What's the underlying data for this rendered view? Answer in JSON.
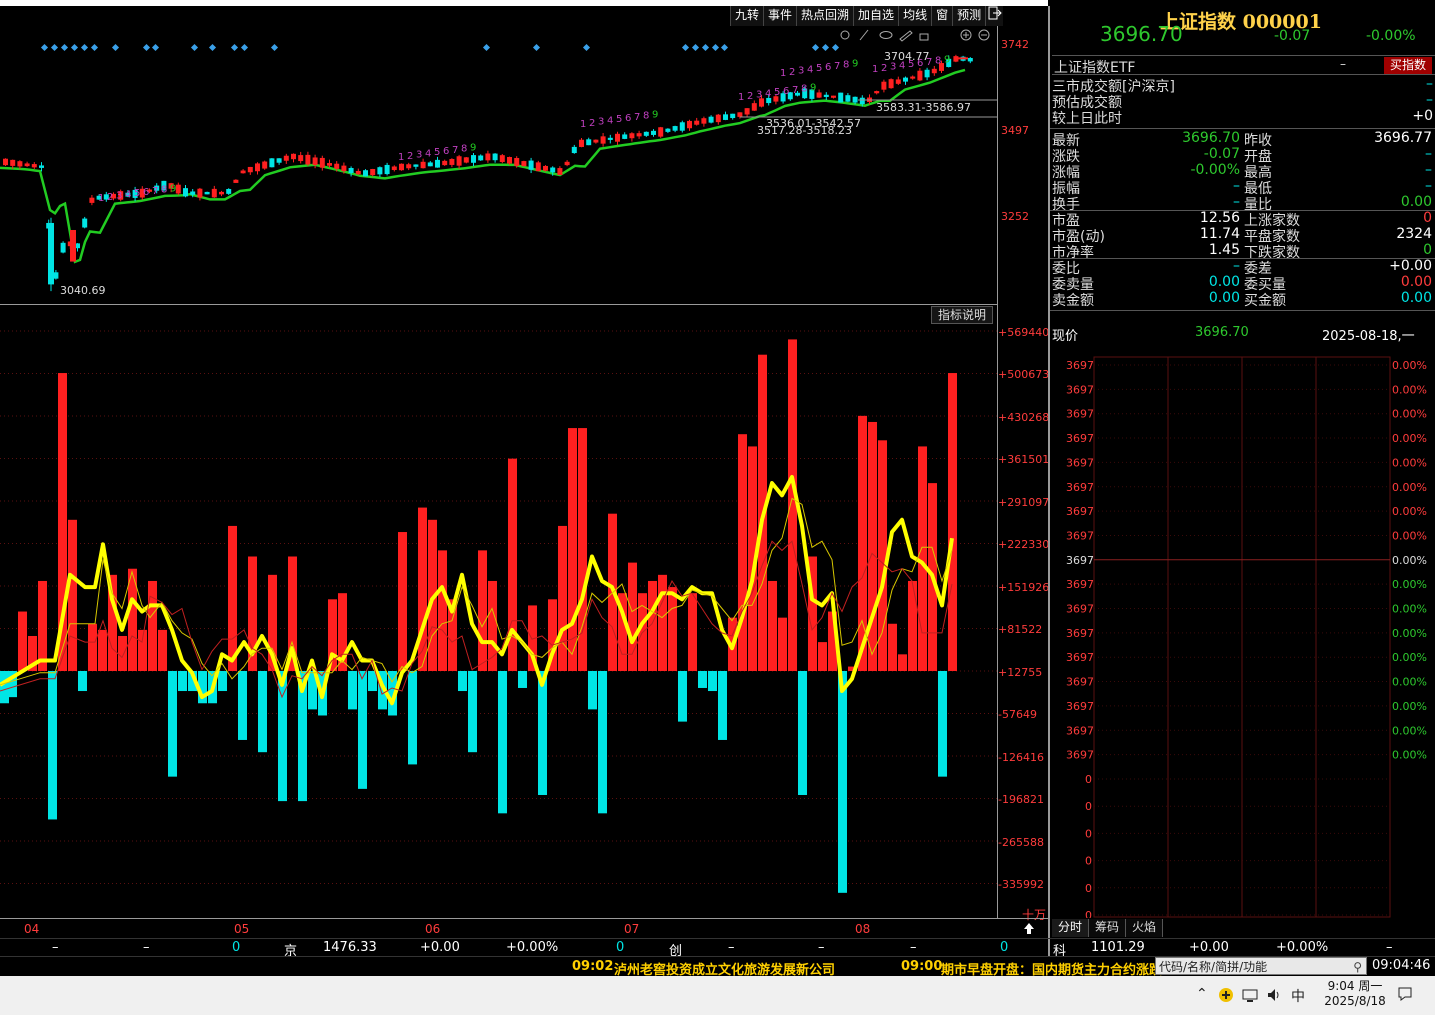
{
  "toolbar": {
    "items": [
      "九转",
      "事件",
      "热点回溯",
      "加自选",
      "均线",
      "窗",
      "预测"
    ],
    "exit_icon": "exit-icon"
  },
  "main_chart": {
    "price_labels": [
      "3742",
      "3497",
      "3252"
    ],
    "low_marker": "3040.69",
    "high_marker": "3704.77",
    "range_label_1": "3583.31-3586.97",
    "range_label_2": "3536.01-3542.57",
    "range_label_3": "3517.28-3518.23",
    "icons": [
      "settings-icon",
      "brush-icon",
      "eye-icon",
      "ruler-icon",
      "lock-icon",
      "zoom-in-icon",
      "zoom-out-icon"
    ]
  },
  "volume_chart": {
    "indicator_button": "指标说明",
    "axis_labels": [
      "+569440",
      "+500673",
      "+430268",
      "+361501",
      "+291097",
      "+222330",
      "+151926",
      "+81522",
      "+12755",
      "-57649",
      "-126416",
      "-196821",
      "-265588",
      "-335992"
    ],
    "unit": "十万"
  },
  "x_axis": {
    "months": [
      "04",
      "05",
      "06",
      "07",
      "08"
    ]
  },
  "index_strip": {
    "dash1": "–",
    "dash2": "–",
    "zero1": "0",
    "jing_label": "京",
    "jing_value": "1476.33",
    "jing_change": "+0.00",
    "jing_pct": "+0.00%",
    "zero2": "0",
    "chuang_label": "创",
    "dash3": "–",
    "dash4": "–",
    "dash5": "–",
    "dash6": "–",
    "zero3": "0",
    "ke_label": "科",
    "ke_value": "1101.29",
    "ke_change": "+0.00",
    "ke_pct": "+0.00%",
    "dash7": "–"
  },
  "ticker": {
    "news1_time": "09:02",
    "news1": "泸州老窖投资成立文化旅游发展新公司",
    "news2_time": "09:00",
    "news2": "期市早盘开盘：国内期货主力合约涨跌",
    "search_placeholder": "代码/名称/简拼/功能",
    "clock": "09:04:46"
  },
  "taskbar": {
    "ime": "中",
    "time": "9:04 周一",
    "date": "2025/8/18"
  },
  "right_panel": {
    "title": "上证指数 000001",
    "price": "3696.70",
    "change": "-0.07",
    "change_pct": "-0.00%",
    "etf_label": "上证指数ETF",
    "etf_dash": "–",
    "buy_button": "买指数",
    "market_rows": [
      {
        "label": "三市成交额[沪深京]",
        "value": "–"
      },
      {
        "label": "预估成交额",
        "value": "–"
      },
      {
        "label": "较上日此时",
        "value": "+0"
      }
    ],
    "quote": {
      "latest_label": "最新",
      "latest": "3696.70",
      "prev_close_label": "昨收",
      "prev_close": "3696.77",
      "change_label": "涨跌",
      "change": "-0.07",
      "open_label": "开盘",
      "open": "–",
      "pct_label": "涨幅",
      "pct": "-0.00%",
      "high_label": "最高",
      "high": "–",
      "amp_label": "振幅",
      "amp": "–",
      "low_label": "最低",
      "low": "–",
      "turnover_label": "换手",
      "turnover": "–",
      "vol_ratio_label": "量比",
      "vol_ratio": "0.00",
      "pe_label": "市盈",
      "pe": "12.56",
      "up_label": "上涨家数",
      "up": "0",
      "pe_dyn_label": "市盈(动)",
      "pe_dyn": "11.74",
      "flat_label": "平盘家数",
      "flat": "2324",
      "pb_label": "市净率",
      "pb": "1.45",
      "down_label": "下跌家数",
      "down": "0",
      "bid_ratio_label": "委比",
      "bid_ratio": "–",
      "bid_diff_label": "委差",
      "bid_diff": "+0.00",
      "sell_vol_label": "委卖量",
      "sell_vol": "0.00",
      "buy_vol_label": "委买量",
      "buy_vol": "0.00",
      "sell_amt_label": "卖金额",
      "sell_amt": "0.00",
      "buy_amt_label": "买金额",
      "buy_amt": "0.00"
    },
    "minute": {
      "now_label": "现价",
      "now_value": "3696.70",
      "date": "2025-08-18,一",
      "price_labels": [
        "3697",
        "3697",
        "3697",
        "3697",
        "3697",
        "3697",
        "3697",
        "3697",
        "3697",
        "3697",
        "3697",
        "3697",
        "3697",
        "3697",
        "3697",
        "3697",
        "3697"
      ],
      "pct_labels": [
        "0.00%",
        "0.00%",
        "0.00%",
        "0.00%",
        "0.00%",
        "0.00%",
        "0.00%",
        "0.00%",
        "0.00%",
        "0.00%",
        "0.00%",
        "0.00%",
        "0.00%",
        "0.00%",
        "0.00%",
        "0.00%",
        "0.00%"
      ],
      "vol_labels": [
        "0",
        "0",
        "0",
        "0",
        "0",
        "0"
      ]
    },
    "tabs": [
      "分时",
      "筹码",
      "火焰"
    ]
  },
  "colors": {
    "up": "#ff2020",
    "down": "#00e5e5",
    "ma": "#22cc22",
    "main_line": "#ffff00",
    "title": "#ffd24a"
  }
}
